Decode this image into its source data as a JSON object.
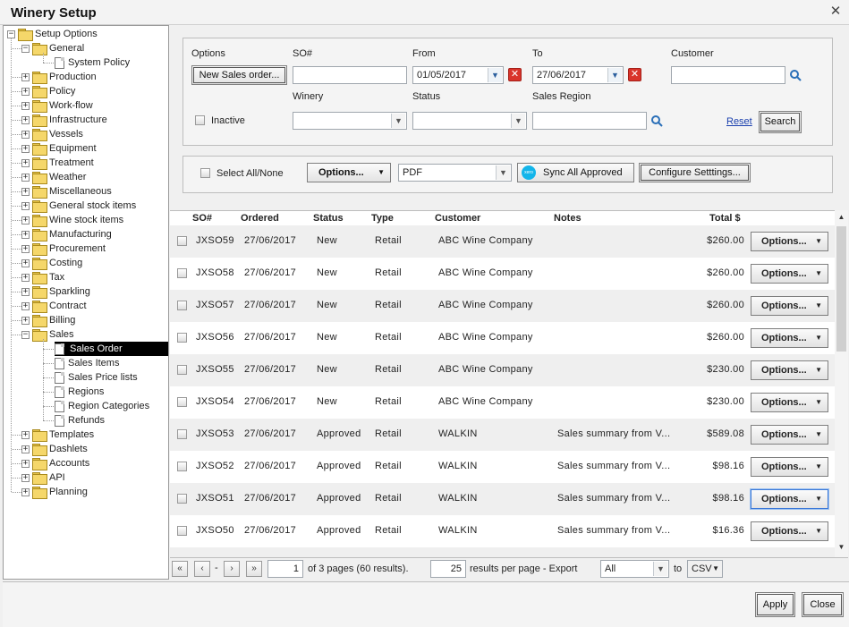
{
  "window": {
    "title": "Winery Setup"
  },
  "tree": {
    "root": "Setup Options",
    "items": [
      {
        "label": "General",
        "level": 1,
        "type": "folder",
        "expanded": true
      },
      {
        "label": "System Policy",
        "level": 2,
        "type": "page"
      },
      {
        "label": "Production",
        "level": 1,
        "type": "folder"
      },
      {
        "label": "Policy",
        "level": 1,
        "type": "folder"
      },
      {
        "label": "Work-flow",
        "level": 1,
        "type": "folder"
      },
      {
        "label": "Infrastructure",
        "level": 1,
        "type": "folder"
      },
      {
        "label": "Vessels",
        "level": 1,
        "type": "folder"
      },
      {
        "label": "Equipment",
        "level": 1,
        "type": "folder"
      },
      {
        "label": "Treatment",
        "level": 1,
        "type": "folder"
      },
      {
        "label": "Weather",
        "level": 1,
        "type": "folder"
      },
      {
        "label": "Miscellaneous",
        "level": 1,
        "type": "folder"
      },
      {
        "label": "General stock items",
        "level": 1,
        "type": "folder"
      },
      {
        "label": "Wine stock items",
        "level": 1,
        "type": "folder"
      },
      {
        "label": "Manufacturing",
        "level": 1,
        "type": "folder"
      },
      {
        "label": "Procurement",
        "level": 1,
        "type": "folder"
      },
      {
        "label": "Costing",
        "level": 1,
        "type": "folder"
      },
      {
        "label": "Tax",
        "level": 1,
        "type": "folder"
      },
      {
        "label": "Sparkling",
        "level": 1,
        "type": "folder"
      },
      {
        "label": "Contract",
        "level": 1,
        "type": "folder"
      },
      {
        "label": "Billing",
        "level": 1,
        "type": "folder"
      },
      {
        "label": "Sales",
        "level": 1,
        "type": "folder",
        "expanded": true
      },
      {
        "label": "Sales Order",
        "level": 2,
        "type": "page",
        "selected": true
      },
      {
        "label": "Sales Items",
        "level": 2,
        "type": "page"
      },
      {
        "label": "Sales Price lists",
        "level": 2,
        "type": "page"
      },
      {
        "label": "Regions",
        "level": 2,
        "type": "page"
      },
      {
        "label": "Region Categories",
        "level": 2,
        "type": "page"
      },
      {
        "label": "Refunds",
        "level": 2,
        "type": "page"
      },
      {
        "label": "Templates",
        "level": 1,
        "type": "folder"
      },
      {
        "label": "Dashlets",
        "level": 1,
        "type": "folder"
      },
      {
        "label": "Accounts",
        "level": 1,
        "type": "folder"
      },
      {
        "label": "API",
        "level": 1,
        "type": "folder"
      },
      {
        "label": "Planning",
        "level": 1,
        "type": "folder"
      }
    ]
  },
  "filter": {
    "options_label": "Options",
    "new_sales_order": "New Sales order...",
    "so_label": "SO#",
    "so_value": "",
    "from_label": "From",
    "from_value": "01/05/2017",
    "to_label": "To",
    "to_value": "27/06/2017",
    "customer_label": "Customer",
    "customer_value": "",
    "inactive_label": "Inactive",
    "winery_label": "Winery",
    "winery_value": "",
    "status_label": "Status",
    "status_value": "",
    "region_label": "Sales Region",
    "region_value": "",
    "reset": "Reset",
    "search": "Search"
  },
  "toolbar": {
    "select_all": "Select All/None",
    "options": "Options...",
    "format": "PDF",
    "sync": "Sync All Approved",
    "sync_badge": "xero",
    "configure": "Configure Setttings..."
  },
  "grid": {
    "columns": [
      "SO#",
      "Ordered",
      "Status",
      "Type",
      "Customer",
      "Notes",
      "Total $"
    ],
    "option_label": "Options...",
    "rows": [
      {
        "so": "JXSO59",
        "ordered": "27/06/2017",
        "status": "New",
        "type": "Retail",
        "customer": "ABC Wine Company",
        "notes": "",
        "total": "$260.00"
      },
      {
        "so": "JXSO58",
        "ordered": "27/06/2017",
        "status": "New",
        "type": "Retail",
        "customer": "ABC Wine Company",
        "notes": "",
        "total": "$260.00"
      },
      {
        "so": "JXSO57",
        "ordered": "27/06/2017",
        "status": "New",
        "type": "Retail",
        "customer": "ABC Wine Company",
        "notes": "",
        "total": "$260.00"
      },
      {
        "so": "JXSO56",
        "ordered": "27/06/2017",
        "status": "New",
        "type": "Retail",
        "customer": "ABC Wine Company",
        "notes": "",
        "total": "$260.00"
      },
      {
        "so": "JXSO55",
        "ordered": "27/06/2017",
        "status": "New",
        "type": "Retail",
        "customer": "ABC Wine Company",
        "notes": "",
        "total": "$230.00"
      },
      {
        "so": "JXSO54",
        "ordered": "27/06/2017",
        "status": "New",
        "type": "Retail",
        "customer": "ABC Wine Company",
        "notes": "",
        "total": "$230.00"
      },
      {
        "so": "JXSO53",
        "ordered": "27/06/2017",
        "status": "Approved",
        "type": "Retail",
        "customer": "WALKIN",
        "notes": "Sales summary from V...",
        "total": "$589.08"
      },
      {
        "so": "JXSO52",
        "ordered": "27/06/2017",
        "status": "Approved",
        "type": "Retail",
        "customer": "WALKIN",
        "notes": "Sales summary from V...",
        "total": "$98.16"
      },
      {
        "so": "JXSO51",
        "ordered": "27/06/2017",
        "status": "Approved",
        "type": "Retail",
        "customer": "WALKIN",
        "notes": "Sales summary from V...",
        "total": "$98.16"
      },
      {
        "so": "JXSO50",
        "ordered": "27/06/2017",
        "status": "Approved",
        "type": "Retail",
        "customer": "WALKIN",
        "notes": "Sales summary from V...",
        "total": "$16.36"
      }
    ]
  },
  "pager": {
    "page": "1",
    "of_text": "of 3 pages (60 results).",
    "per_page": "25",
    "per_page_text": "results per page - Export",
    "export_scope": "All",
    "to_text": "to",
    "export_format": "CSV",
    "dash": "-"
  },
  "footer": {
    "apply": "Apply",
    "close": "Close"
  }
}
